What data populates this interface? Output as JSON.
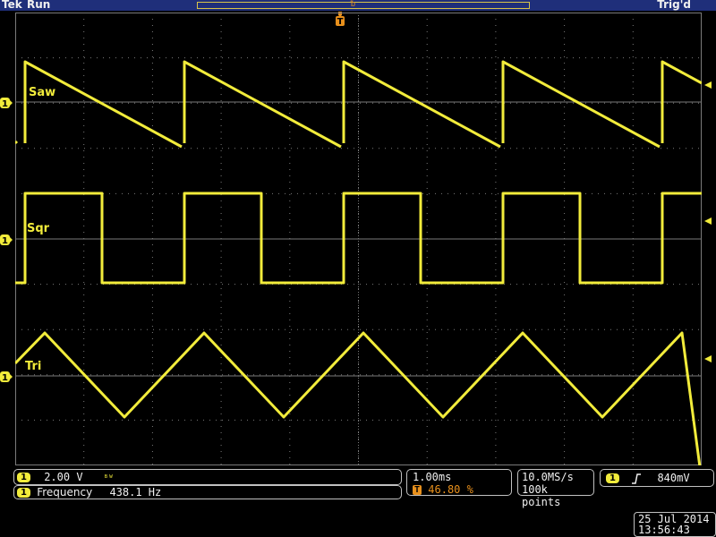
{
  "header": {
    "brand": "Tek",
    "acq_state": "Run",
    "trigger_state": "Trig'd"
  },
  "markers": {
    "channel": "1",
    "trigger": "T",
    "record_marker": "ᵬ"
  },
  "traces": [
    {
      "label": "Saw",
      "type": "sawtooth"
    },
    {
      "label": "Sqr",
      "type": "square"
    },
    {
      "label": "Tri",
      "type": "triangle"
    }
  ],
  "colors": {
    "trace": "#f2ec3b",
    "grid": "#7a7a7a",
    "topbar": "#1f2f7a",
    "trigger_marker": "#e8901c"
  },
  "status": {
    "channel_scale": "2.00 V",
    "bandwidth_icon": "bandwidth-limit-icon",
    "measurement_label": "Frequency",
    "measurement_value": "438.1 Hz",
    "timebase": "1.00ms",
    "trigger_position": "46.80 %",
    "sample_rate": "10.0MS/s",
    "record_length": "100k points",
    "trigger_slope_icon": "rising-edge-icon",
    "trigger_level": "840mV"
  },
  "datetime": {
    "date": "25 Jul  2014",
    "time": "13:56:43"
  }
}
